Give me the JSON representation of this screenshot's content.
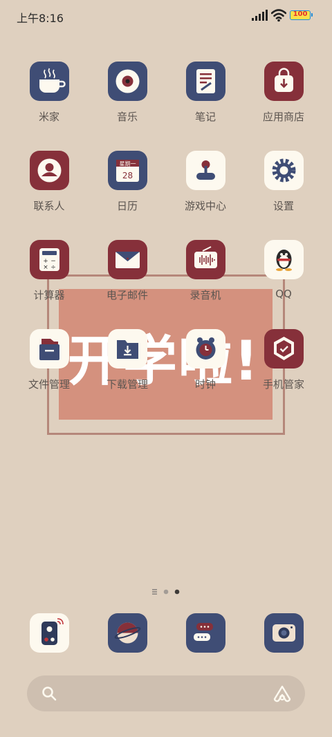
{
  "status_bar": {
    "time": "上午8:16",
    "battery": "100"
  },
  "wallpaper": {
    "text": "开学啦!"
  },
  "apps": [
    {
      "label": "米家",
      "icon": "mijia-icon"
    },
    {
      "label": "音乐",
      "icon": "music-icon"
    },
    {
      "label": "笔记",
      "icon": "notes-icon"
    },
    {
      "label": "应用商店",
      "icon": "app-store-icon"
    },
    {
      "label": "联系人",
      "icon": "contacts-icon"
    },
    {
      "label": "日历",
      "icon": "calendar-icon",
      "weekday": "星期一",
      "day": "28"
    },
    {
      "label": "游戏中心",
      "icon": "game-center-icon"
    },
    {
      "label": "设置",
      "icon": "settings-icon"
    },
    {
      "label": "计算器",
      "icon": "calculator-icon"
    },
    {
      "label": "电子邮件",
      "icon": "email-icon"
    },
    {
      "label": "录音机",
      "icon": "recorder-icon"
    },
    {
      "label": "QQ",
      "icon": "qq-icon"
    },
    {
      "label": "文件管理",
      "icon": "file-manager-icon"
    },
    {
      "label": "下载管理",
      "icon": "download-manager-icon"
    },
    {
      "label": "时钟",
      "icon": "clock-icon"
    },
    {
      "label": "手机管家",
      "icon": "security-icon"
    }
  ],
  "dock": [
    {
      "icon": "phone-icon"
    },
    {
      "icon": "browser-icon"
    },
    {
      "icon": "messages-icon"
    },
    {
      "icon": "camera-icon"
    }
  ],
  "colors": {
    "background": "#dfd0bf",
    "navy": "#3f4d75",
    "red": "#86303a",
    "cream": "#fdf9ef",
    "wallpaper_block": "#d4917e"
  }
}
